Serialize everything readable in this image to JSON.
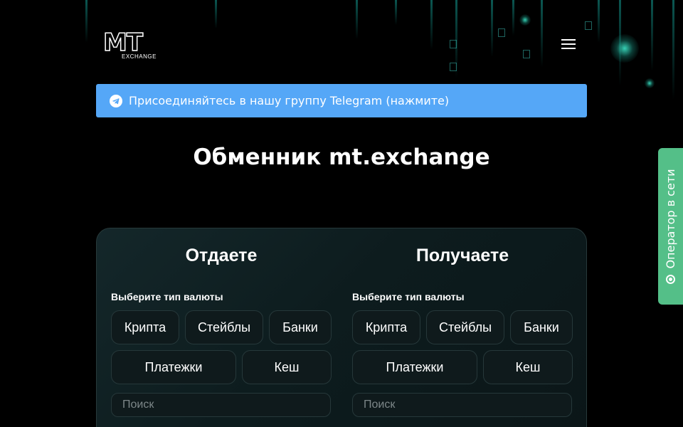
{
  "header": {
    "logo_main": "MT",
    "logo_sub": "EXCHANGE",
    "menu_icon": "hamburger-menu-icon"
  },
  "banner": {
    "icon": "telegram-icon",
    "text": "Присоединяйтесь в нашу группу Telegram (нажмите)",
    "color": "#55a7f7"
  },
  "page_title": "Обменник mt.exchange",
  "give": {
    "title": "Отдаете",
    "subtitle": "Выберите тип валюты",
    "types_row1": [
      "Крипта",
      "Стейблы",
      "Банки"
    ],
    "types_row2": [
      "Платежки",
      "Кеш"
    ],
    "search_placeholder": "Поиск"
  },
  "receive": {
    "title": "Получаете",
    "subtitle": "Выберите тип валюты",
    "types_row1": [
      "Крипта",
      "Стейблы",
      "Банки"
    ],
    "types_row2": [
      "Платежки",
      "Кеш"
    ],
    "search_placeholder": "Поиск"
  },
  "operator": {
    "label": "Оператор в сети",
    "icon": "online-dot-icon",
    "color": "#54bf88"
  }
}
